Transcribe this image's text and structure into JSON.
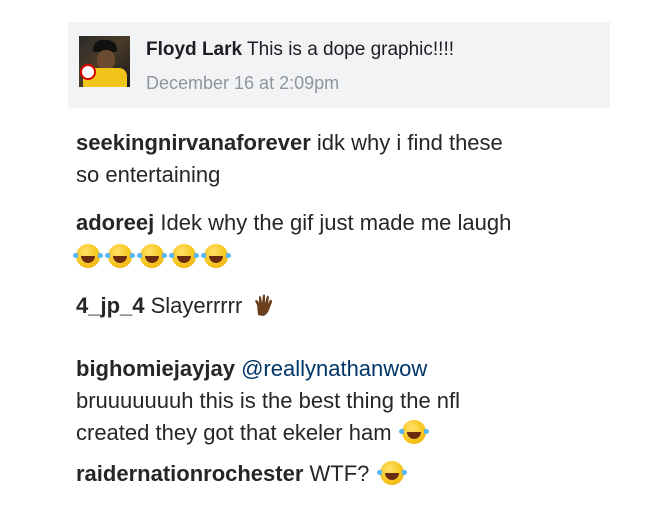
{
  "fb_comment": {
    "name": "Floyd Lark",
    "text": "This is a dope graphic!!!!",
    "time": "December 16 at 2:09pm"
  },
  "comments": [
    {
      "user": "seekingnirvanaforever",
      "text": "idk why i find these",
      "text2": "so entertaining"
    },
    {
      "user": "adoreej",
      "text": "Idek why the gif just made me laugh"
    },
    {
      "user": "4_jp_4",
      "text": "Slayerrrrr"
    },
    {
      "user": "bighomiejayjay",
      "mention": "@reallynathanwow",
      "text": "bruuuuuuuh this is the best thing the nfl",
      "text2": "created they got that ekeler ham"
    },
    {
      "user": "raidernationrochester",
      "text": "WTF?"
    }
  ],
  "icons": {
    "laugh": "face-with-tears-of-joy-icon",
    "vulcan": "vulcan-salute-icon",
    "emoji_color": "#f7c21a"
  }
}
